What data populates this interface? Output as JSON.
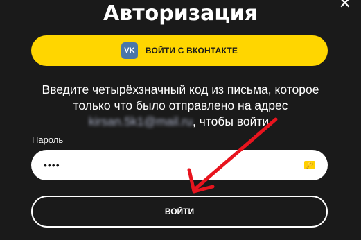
{
  "dialog": {
    "title": "Авторизация",
    "close_glyph": "✕",
    "vk_button": {
      "icon": "vk-logo-icon",
      "logo_text": "VK",
      "label": "ВОЙТИ С ВКОНТАКТЕ",
      "color": "#ffd600"
    },
    "description": {
      "line1": "Введите четырёхзначный код из письма, которое",
      "line2": "только что было отправлено на адрес",
      "email_blurred": "kirsan.5k1@mail.ru",
      "line3_suffix": ", чтобы войти."
    },
    "password": {
      "label": "Пароль",
      "value": "••••",
      "key_icon": "password-manager-key-icon"
    },
    "submit_label": "ВОЙТИ"
  },
  "annotation": {
    "arrow_color": "#e8141e"
  }
}
